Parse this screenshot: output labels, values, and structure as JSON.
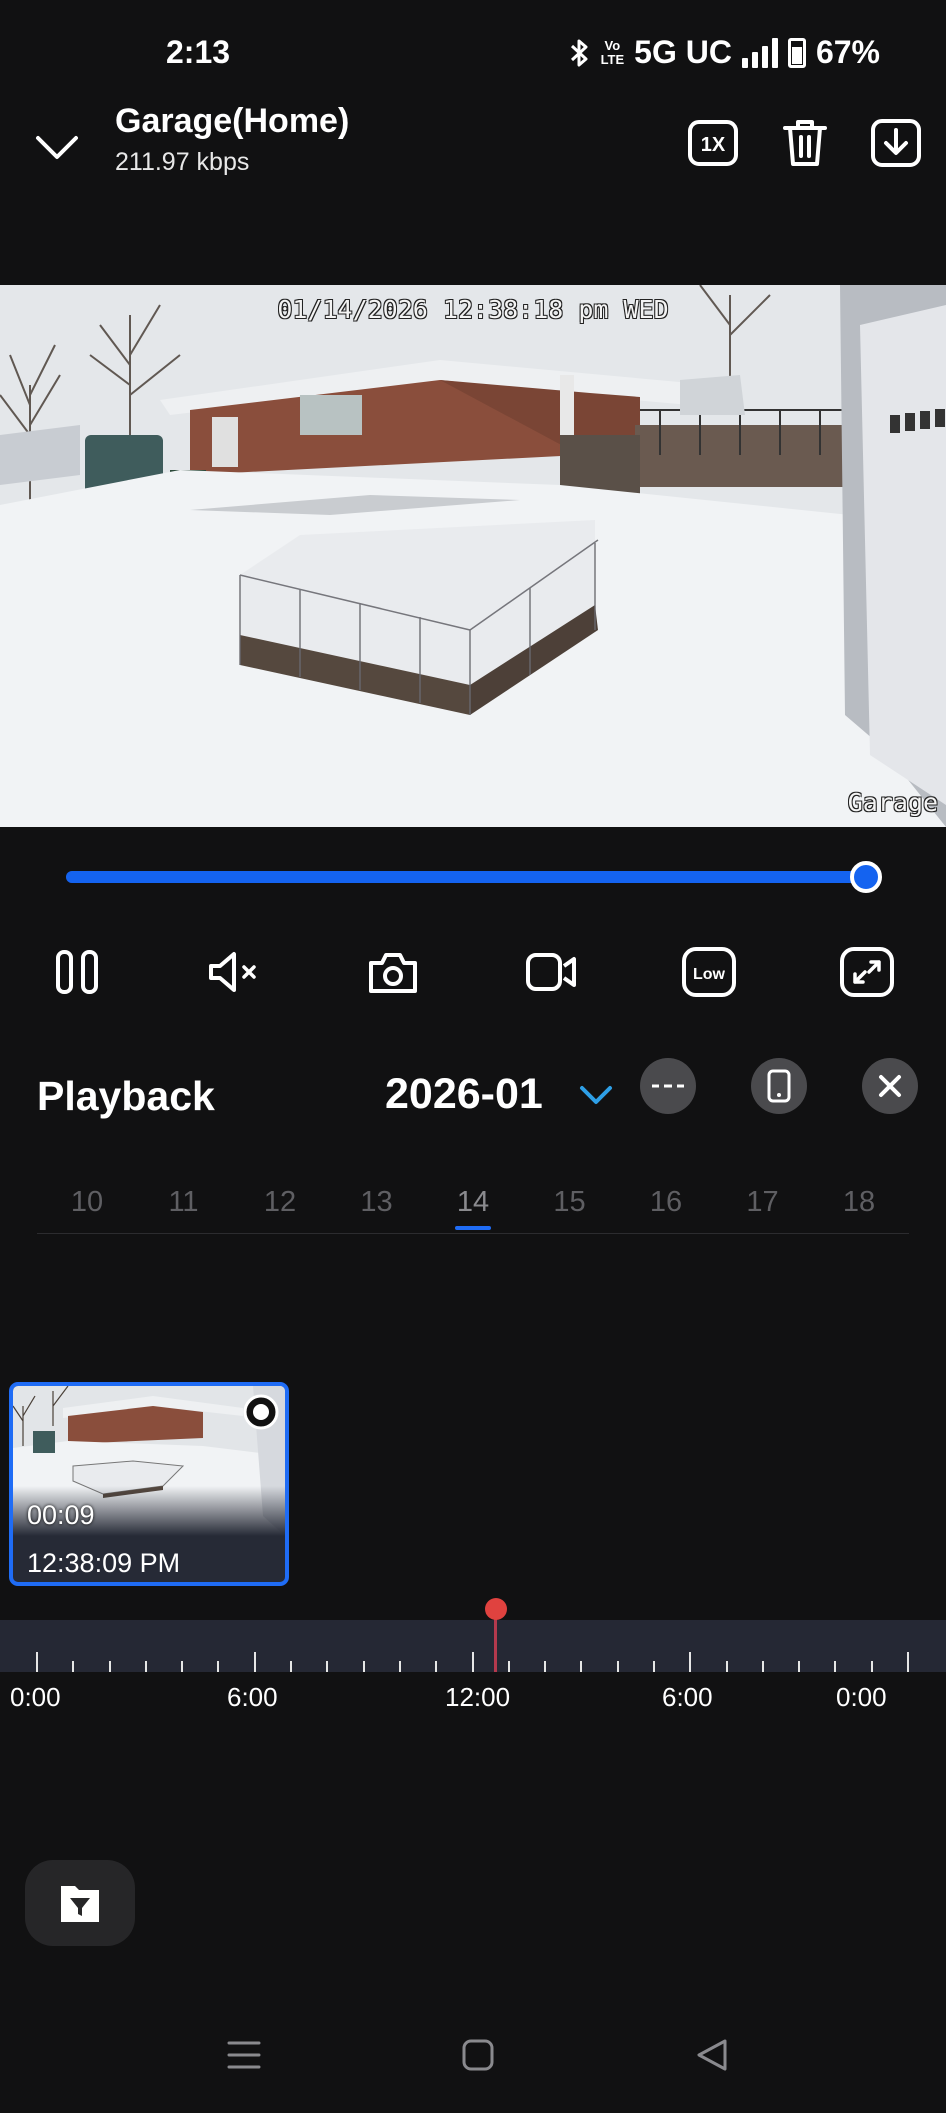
{
  "status_bar": {
    "time": "2:13",
    "volte": "Vo\nLTE",
    "network": "5G UC",
    "battery": "67%",
    "icons": [
      "bluetooth-icon",
      "volte-icon",
      "signal-icon",
      "battery-icon"
    ]
  },
  "header": {
    "title": "Garage(Home)",
    "bitrate": "211.97 kbps",
    "speed_label": "1X",
    "icons": [
      "chevron-down-icon",
      "speed-1x-icon",
      "trash-icon",
      "download-icon"
    ]
  },
  "video": {
    "osd_timestamp": "01/14/2026 12:38:18 pm WED",
    "osd_camera_name": "Garage"
  },
  "progress": {
    "fraction": 1.0
  },
  "controls": {
    "icons": [
      "pause-icon",
      "mute-icon",
      "snapshot-icon",
      "record-icon",
      "quality-low-icon",
      "fullscreen-icon"
    ],
    "quality_label": "Low"
  },
  "playback": {
    "title": "Playback",
    "month": "2026-01",
    "more_label": "---",
    "icons": [
      "more-icon",
      "phone-icon",
      "close-icon"
    ]
  },
  "days": {
    "items": [
      "10",
      "11",
      "12",
      "13",
      "14",
      "15",
      "16",
      "17",
      "18"
    ],
    "selected": "14"
  },
  "clip": {
    "duration": "00:09",
    "time": "12:38:09 PM"
  },
  "timeline": {
    "labels": [
      "0:00",
      "6:00",
      "12:00",
      "6:00",
      "0:00"
    ],
    "playhead_hour": 12.7
  },
  "colors": {
    "accent": "#1f6cf5",
    "background": "#111112",
    "playhead": "#e0423f"
  }
}
